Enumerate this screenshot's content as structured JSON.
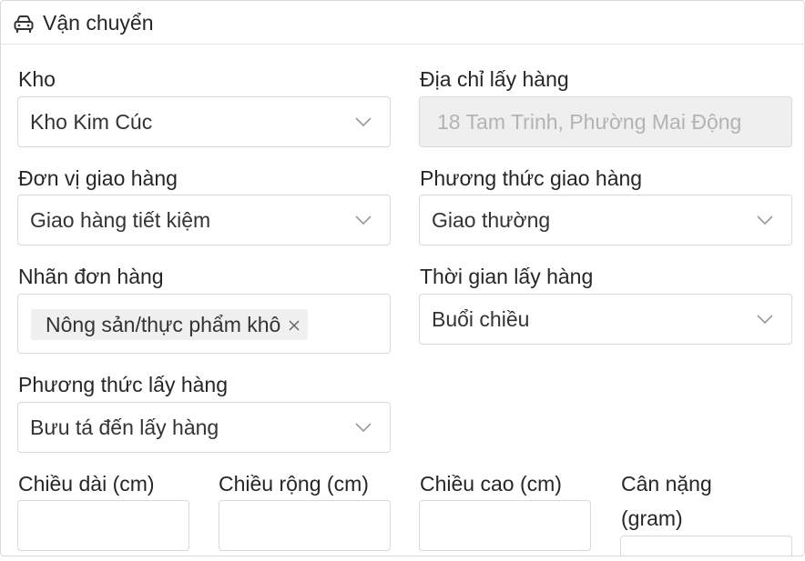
{
  "section": {
    "title": "Vận chuyển",
    "icon": "car-icon"
  },
  "fields": {
    "warehouse": {
      "label": "Kho",
      "value": "Kho Kim Cúc"
    },
    "pickup_address": {
      "label": "Địa chỉ lấy hàng",
      "value": "18 Tam Trinh, Phường Mai Động"
    },
    "carrier": {
      "label": "Đơn vị giao hàng",
      "value": "Giao hàng tiết kiệm"
    },
    "delivery_method": {
      "label": "Phương thức giao hàng",
      "value": "Giao thường"
    },
    "order_tags": {
      "label": "Nhãn đơn hàng",
      "tags": [
        "Nông sản/thực phẩm khô"
      ]
    },
    "pickup_time": {
      "label": "Thời gian lấy hàng",
      "value": "Buổi chiều"
    },
    "pickup_method": {
      "label": "Phương thức lấy hàng",
      "value": "Bưu tá đến lấy hàng"
    },
    "length": {
      "label": "Chiều dài (cm)",
      "value": ""
    },
    "width": {
      "label": "Chiều rộng (cm)",
      "value": ""
    },
    "height": {
      "label": "Chiều cao (cm)",
      "value": ""
    },
    "weight": {
      "label_line1": "Cân nặng",
      "label_line2": "(gram)",
      "value": ""
    }
  },
  "colors": {
    "border": "#d9d9d9",
    "disabled_bg": "#efefef",
    "tag_bg": "#f0f0f0",
    "text": "#262626"
  }
}
